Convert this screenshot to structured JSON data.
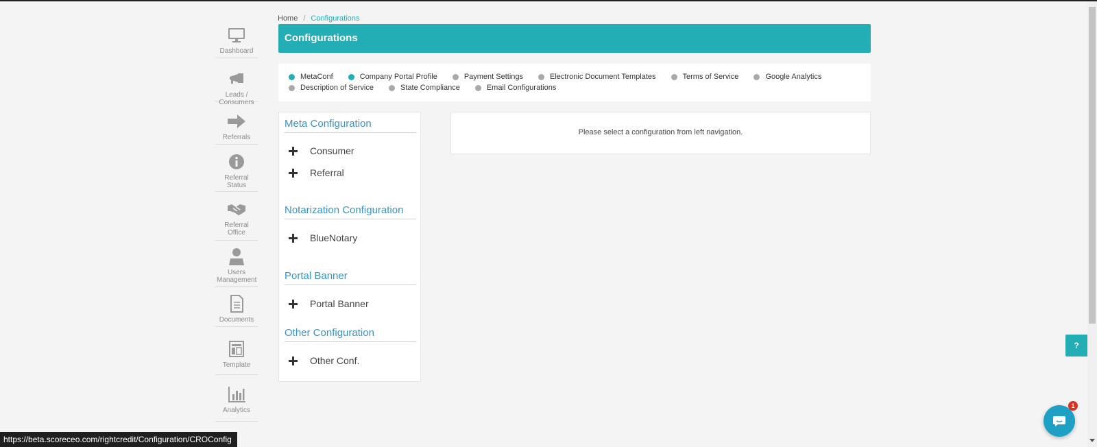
{
  "breadcrumb": {
    "home": "Home",
    "separator": "/",
    "current": "Configurations"
  },
  "header": {
    "title": "Configurations"
  },
  "sidenav": [
    {
      "label": "Dashboard",
      "icon": "monitor-icon"
    },
    {
      "label": "Leads / Consumers",
      "icon": "megaphone-icon"
    },
    {
      "label": "Referrals",
      "icon": "arrow-right-icon"
    },
    {
      "label": "Referral Status",
      "icon": "info-icon"
    },
    {
      "label": "Referral Office",
      "icon": "handshake-icon"
    },
    {
      "label": "Users Management",
      "icon": "user-icon"
    },
    {
      "label": "Documents",
      "icon": "document-icon"
    },
    {
      "label": "Template",
      "icon": "template-icon"
    },
    {
      "label": "Analytics",
      "icon": "bar-chart-icon"
    }
  ],
  "steps": {
    "row1": [
      {
        "label": "MetaConf",
        "active": true
      },
      {
        "label": "Company Portal Profile",
        "active": true
      },
      {
        "label": "Payment Settings",
        "active": false
      },
      {
        "label": "Electronic Document Templates",
        "active": false
      },
      {
        "label": "Terms of Service",
        "active": false
      },
      {
        "label": "Google Analytics",
        "active": false
      }
    ],
    "row2": [
      {
        "label": "Description of Service",
        "active": false
      },
      {
        "label": "State Compliance",
        "active": false
      },
      {
        "label": "Email Configurations",
        "active": false
      }
    ]
  },
  "config": {
    "sections": [
      {
        "title": "Meta Configuration",
        "items": [
          "Consumer",
          "Referral"
        ]
      },
      {
        "title": "Notarization Configuration",
        "items": [
          "BlueNotary"
        ]
      },
      {
        "title": "Portal Banner",
        "items": [
          "Portal Banner"
        ]
      },
      {
        "title": "Other Configuration",
        "items": [
          "Other Conf."
        ]
      }
    ]
  },
  "message": "Please select a configuration from left navigation.",
  "status_url": "https://beta.scoreceo.com/rightcredit/Configuration/CROConfig",
  "help_label": "?",
  "chat_badge": "1",
  "colors": {
    "accent": "#22aeb4",
    "section_title": "#3a93c8",
    "inactive_dot": "#a9a9a9",
    "badge": "#d9301f"
  }
}
